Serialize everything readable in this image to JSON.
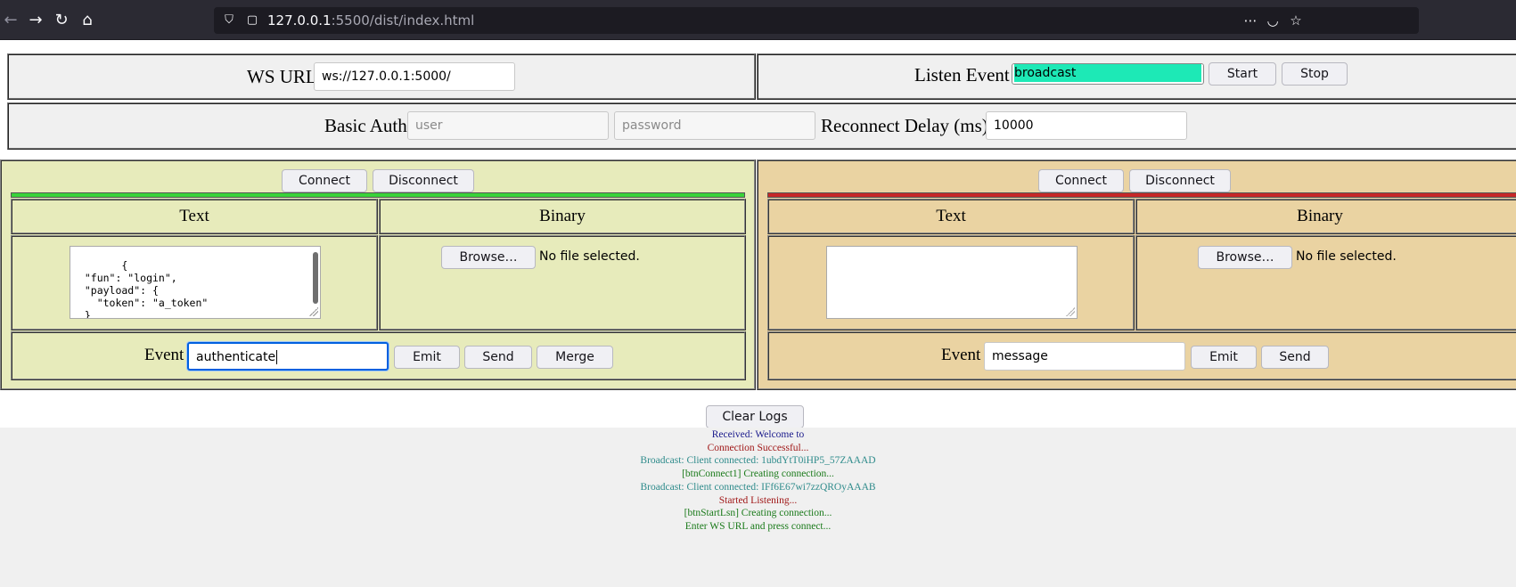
{
  "browser": {
    "url_host": "127.0.0.1",
    "url_rest": ":5500/dist/index.html",
    "back_icon": "arrow-left",
    "forward_icon": "arrow-right",
    "reload_icon": "reload",
    "home_icon": "home",
    "shield_icon": "shield",
    "page_icon": "page",
    "menu_icon": "ellipsis",
    "pocket_icon": "pocket",
    "bookmark_icon": "star"
  },
  "ws": {
    "label": "WS URL",
    "value": "ws://127.0.0.1:5000/"
  },
  "listen": {
    "label": "Listen Event",
    "value": "broadcast",
    "highlight_color": "#1de9b6",
    "start_label": "Start",
    "stop_label": "Stop"
  },
  "auth": {
    "label": "Basic Auth",
    "user_placeholder": "user",
    "password_placeholder": "password",
    "reconnect_label": "Reconnect Delay (ms)",
    "reconnect_value": "10000"
  },
  "left_client": {
    "connect_label": "Connect",
    "disconnect_label": "Disconnect",
    "status_color": "#39d339",
    "text_header": "Text",
    "binary_header": "Binary",
    "text_value": "{\n  \"fun\": \"login\",\n  \"payload\": {\n    \"token\": \"a_token\"\n  }\n}",
    "browse_label": "Browse…",
    "file_status": "No file selected.",
    "event_label": "Event",
    "event_value": "authenticate",
    "emit_label": "Emit",
    "send_label": "Send",
    "merge_label": "Merge",
    "bg_color": "#e7ebbb"
  },
  "right_client": {
    "connect_label": "Connect",
    "disconnect_label": "Disconnect",
    "status_color": "#c62828",
    "text_header": "Text",
    "binary_header": "Binary",
    "text_value": "",
    "browse_label": "Browse…",
    "file_status": "No file selected.",
    "event_label": "Event",
    "event_value": "message",
    "emit_label": "Emit",
    "send_label": "Send",
    "bg_color": "#ead3a2"
  },
  "logs": {
    "clear_label": "Clear Logs",
    "lines": [
      {
        "text": "Received: Welcome to",
        "color": "#1a1a8c"
      },
      {
        "text": "Connection Successful...",
        "color": "#a01818"
      },
      {
        "text": "Broadcast: Client connected: 1ubdYtT0iHP5_57ZAAAD",
        "color": "#2e8b8b"
      },
      {
        "text": "[btnConnect1] Creating connection...",
        "color": "#1a7a1a"
      },
      {
        "text": "Broadcast: Client connected: IFf6E67wi7zzQROyAAAB",
        "color": "#2e8b8b"
      },
      {
        "text": "Started Listening...",
        "color": "#a01818"
      },
      {
        "text": "[btnStartLsn] Creating connection...",
        "color": "#1a7a1a"
      },
      {
        "text": "Enter WS URL and press connect...",
        "color": "#1a7a1a"
      }
    ]
  }
}
